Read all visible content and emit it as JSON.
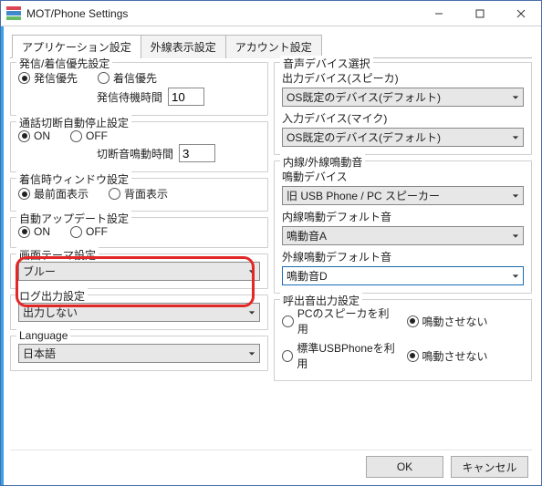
{
  "window": {
    "title": "MOT/Phone Settings"
  },
  "tabs": {
    "app": "アプリケーション設定",
    "ext": "外線表示設定",
    "acct": "アカウント設定"
  },
  "outgoing": {
    "title": "発信/着信優先設定",
    "opt1": "発信優先",
    "opt2": "着信優先",
    "wait_label": "発信待機時間",
    "wait_value": "10"
  },
  "disconnect": {
    "title": "通話切断自動停止設定",
    "on": "ON",
    "off": "OFF",
    "ring_label": "切断音鳴動時間",
    "ring_value": "3"
  },
  "incomingWin": {
    "title": "着信時ウィンドウ設定",
    "front": "最前面表示",
    "back": "背面表示"
  },
  "autoUpdate": {
    "title": "自動アップデート設定",
    "on": "ON",
    "off": "OFF"
  },
  "theme": {
    "title": "画面テーマ設定",
    "value": "ブルー"
  },
  "log": {
    "title": "ログ出力設定",
    "value": "出力しない"
  },
  "lang": {
    "title": "Language",
    "value": "日本語"
  },
  "audio": {
    "title": "音声デバイス選択",
    "out_label": "出力デバイス(スピーカ)",
    "out_value": "OS既定のデバイス(デフォルト)",
    "in_label": "入力デバイス(マイク)",
    "in_value": "OS既定のデバイス(デフォルト)"
  },
  "ring": {
    "title": "内線/外線鳴動音",
    "dev_label": "鳴動デバイス",
    "dev_value": "旧 USB Phone / PC スピーカー",
    "int_label": "内線鳴動デフォルト音",
    "int_value": "鳴動音A",
    "ext_label": "外線鳴動デフォルト音",
    "ext_value": "鳴動音D"
  },
  "callout": {
    "title": "呼出音出力設定",
    "a1": "PCのスピーカを利用",
    "a2": "鳴動させない",
    "b1": "標準USBPhoneを利用",
    "b2": "鳴動させない"
  },
  "buttons": {
    "ok": "OK",
    "cancel": "キャンセル"
  }
}
